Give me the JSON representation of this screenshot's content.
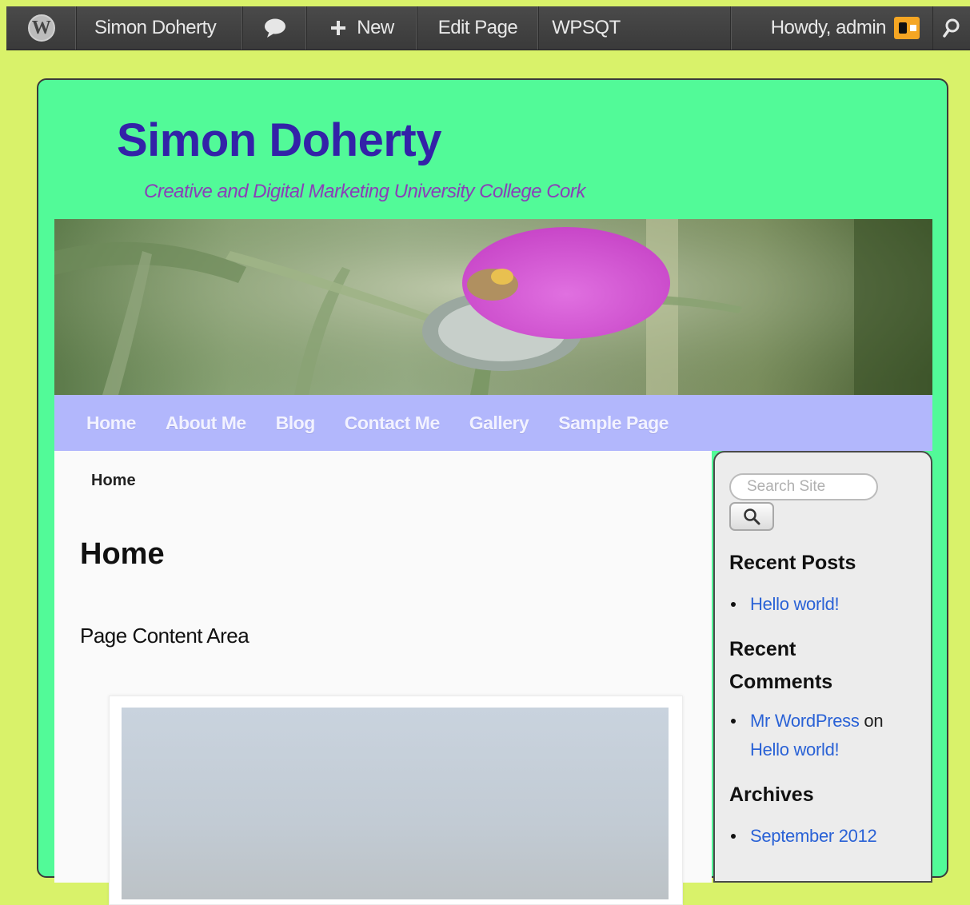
{
  "admin_bar": {
    "site_name": "Simon Doherty",
    "new_label": "New",
    "edit_page_label": "Edit Page",
    "plugin_label": "WPSQT",
    "howdy_label": "Howdy, admin"
  },
  "site": {
    "title": "Simon Doherty",
    "description": "Creative and Digital Marketing University College Cork"
  },
  "nav": {
    "items": [
      "Home",
      "About Me",
      "Blog",
      "Contact Me",
      "Gallery",
      "Sample Page"
    ]
  },
  "content": {
    "breadcrumb": "Home",
    "title": "Home",
    "text": "Page Content Area"
  },
  "sidebar": {
    "search_placeholder": "Search Site",
    "recent_posts_title": "Recent Posts",
    "recent_posts": [
      "Hello world!"
    ],
    "recent_comments_title_line1": "Recent",
    "recent_comments_title_line2": "Comments",
    "recent_comment": {
      "author": "Mr WordPress",
      "connector": "on",
      "post": "Hello world!"
    },
    "archives_title": "Archives",
    "archives": [
      "September 2012"
    ]
  },
  "colors": {
    "page_bg": "#d9f26a",
    "container_bg": "#52fa98",
    "title_color": "#3322a8",
    "desc_color": "#8a3fb8",
    "nav_bg": "#b2b7fc",
    "link_color": "#2a62d6"
  }
}
